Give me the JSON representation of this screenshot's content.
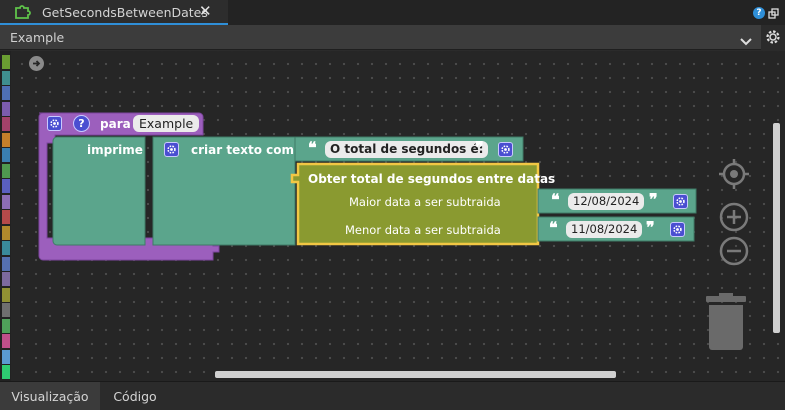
{
  "tab": {
    "title": "GetSecondsBetweenDates",
    "close": "✕"
  },
  "help_icon": "?",
  "selector": {
    "value": "Example"
  },
  "category_colors": [
    "#6a9e32",
    "#3f8f8f",
    "#4e6fb4",
    "#7c5cad",
    "#a3426a",
    "#c47f2a",
    "#3a7fb0",
    "#4f9a4f",
    "#5a5fc0",
    "#8c6db5",
    "#b54a4a",
    "#b08a2c",
    "#3a8a9a",
    "#5570b0",
    "#7d6a9e",
    "#909033",
    "#6f6f6f",
    "#4fa05a",
    "#c04f8a",
    "#5a9ad0",
    "#2ecc71"
  ],
  "blocks": {
    "proc": {
      "label": "para",
      "name": "Example",
      "help": "?"
    },
    "print": {
      "label": "imprime"
    },
    "text_join": {
      "label": "criar texto com"
    },
    "text_literal": {
      "open_quote": "❝",
      "value": "O total de segundos é:",
      "close_quote": "❞"
    },
    "seconds_between": {
      "title": "Obter total de segundos entre datas",
      "arg1_label": "Maior data a ser subtraida",
      "arg2_label": "Menor data a ser subtraida"
    },
    "date1": {
      "open_quote": "❝",
      "value": "12/08/2024",
      "close_quote": "❞"
    },
    "date2": {
      "open_quote": "❝",
      "value": "11/08/2024",
      "close_quote": "❞"
    }
  },
  "bottom_tabs": {
    "visualizacao": "Visualização",
    "codigo": "Código"
  },
  "colors": {
    "procedure": "#9c5fbd",
    "print_block": "#5ba58c",
    "text_block": "#5ba58c",
    "function_block": "#8a9a30",
    "selected_outline": "#f2c744",
    "accent": "#2f8fd8"
  }
}
